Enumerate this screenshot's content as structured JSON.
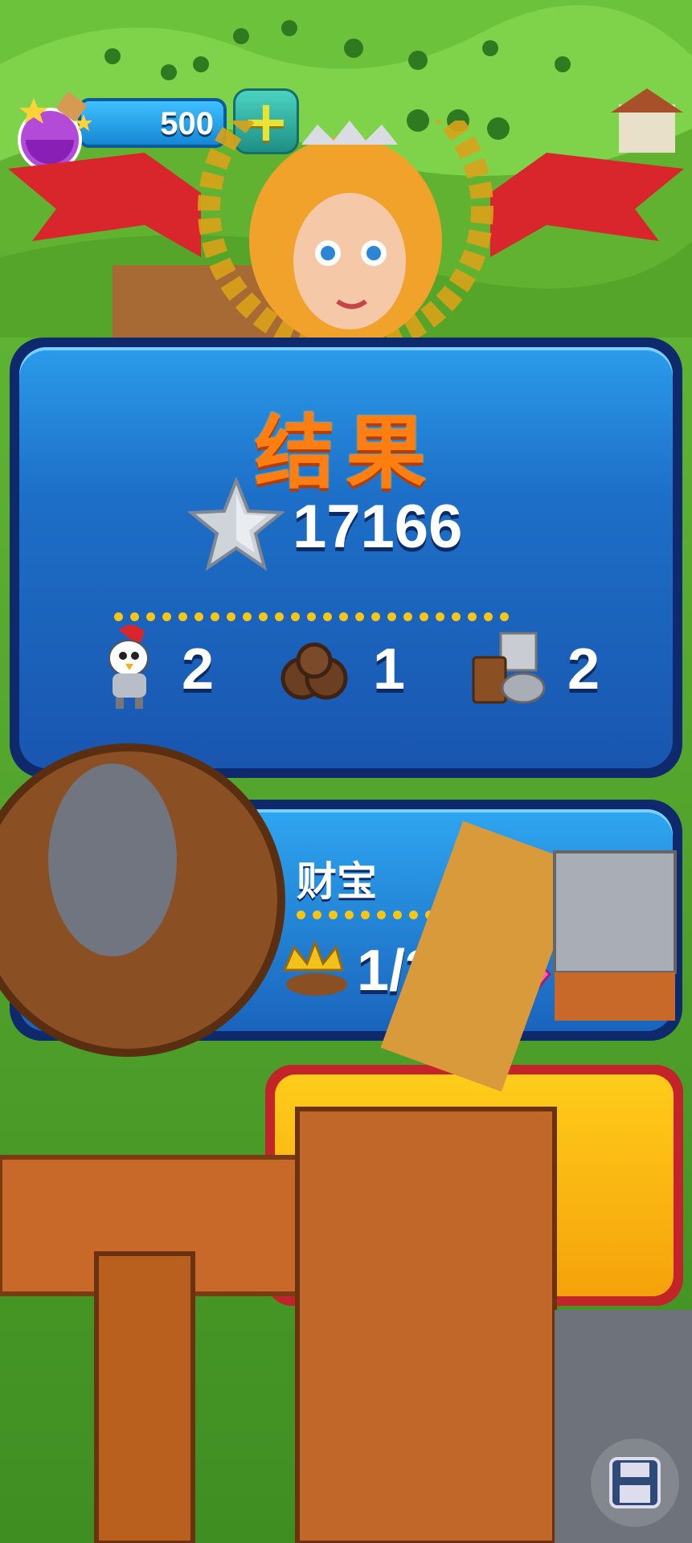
{
  "hud": {
    "potion_count": "500",
    "plus_label": "+"
  },
  "result": {
    "title": "结果",
    "score": "17166",
    "stats": [
      {
        "icon": "knight-rooster-icon",
        "value": "2"
      },
      {
        "icon": "rope-bundle-icon",
        "value": "1"
      },
      {
        "icon": "wood-stone-resources-icon",
        "value": "2"
      }
    ]
  },
  "treasure": {
    "title": "财宝",
    "progress": "1/3"
  },
  "colors": {
    "title_orange": "#ff7e12",
    "panel_blue": "#1d6fc7",
    "panel_border": "#0e2a6d",
    "dot_yellow": "#f5c518"
  }
}
